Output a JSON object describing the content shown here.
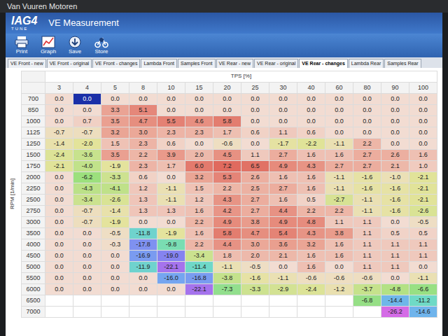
{
  "frame": {
    "label": "Van Vuuren Motoren"
  },
  "logo": {
    "text": "IAG4",
    "sub": "TUNE"
  },
  "window": {
    "title": "VE Measurement"
  },
  "toolbar": [
    {
      "label": "Print"
    },
    {
      "label": "Graph"
    },
    {
      "label": "Save"
    },
    {
      "label": "Store"
    }
  ],
  "tabs": [
    {
      "label": "VE Front - new",
      "selected": false
    },
    {
      "label": "VE Front - original",
      "selected": false
    },
    {
      "label": "VE Front - changes",
      "selected": false
    },
    {
      "label": "Lambda Front",
      "selected": false
    },
    {
      "label": "Samples Front",
      "selected": false
    },
    {
      "label": "VE Rear - new",
      "selected": false
    },
    {
      "label": "VE Rear - original",
      "selected": false
    },
    {
      "label": "VE Rear - changes",
      "selected": true
    },
    {
      "label": "Lambda Rear",
      "selected": false
    },
    {
      "label": "Samples Rear",
      "selected": false
    }
  ],
  "table": {
    "x_axis": "TPS [%]",
    "y_axis": "RPM [1/min]",
    "columns": [
      "3",
      "4",
      "5",
      "8",
      "10",
      "15",
      "20",
      "25",
      "30",
      "40",
      "60",
      "80",
      "90",
      "100"
    ],
    "selected_cell": {
      "row": "700",
      "column": "4"
    },
    "rows": [
      {
        "label": "700",
        "cells": [
          "0.0",
          "0.0",
          "0.0",
          "0.0",
          "0.0",
          "0.0",
          "0.0",
          "0.0",
          "0.0",
          "0.0",
          "0.0",
          "0.0",
          "0.0",
          "0.0"
        ]
      },
      {
        "label": "850",
        "cells": [
          "0.0",
          "0.0",
          "3.3",
          "5.1",
          "0.0",
          "0.0",
          "0.0",
          "0.0",
          "0.0",
          "0.0",
          "0.0",
          "0.0",
          "0.0",
          "0.0"
        ]
      },
      {
        "label": "1000",
        "cells": [
          "0.0",
          "0.7",
          "3.5",
          "4.7",
          "5.5",
          "4.6",
          "5.8",
          "0.0",
          "0.0",
          "0.0",
          "0.0",
          "0.0",
          "0.0",
          "0.0"
        ]
      },
      {
        "label": "1125",
        "cells": [
          "-0.7",
          "-0.7",
          "3.2",
          "3.0",
          "2.3",
          "2.3",
          "1.7",
          "0.6",
          "1.1",
          "0.6",
          "0.0",
          "0.0",
          "0.0",
          "0.0"
        ]
      },
      {
        "label": "1250",
        "cells": [
          "-1.4",
          "-2.0",
          "1.5",
          "2.3",
          "0.6",
          "0.0",
          "-0.6",
          "0.0",
          "-1.7",
          "-2.2",
          "-1.1",
          "2.2",
          "0.0",
          "0.0"
        ]
      },
      {
        "label": "1500",
        "cells": [
          "-2.4",
          "-3.6",
          "3.5",
          "2.2",
          "3.9",
          "2.0",
          "4.5",
          "1.1",
          "2.7",
          "1.6",
          "1.6",
          "2.7",
          "2.6",
          "1.6"
        ]
      },
      {
        "label": "1750",
        "cells": [
          "-2.1",
          "-4.0",
          "-1.9",
          "2.3",
          "1.7",
          "6.0",
          "7.2",
          "6.5",
          "4.9",
          "4.3",
          "2.7",
          "2.7",
          "2.1",
          "1.0"
        ]
      },
      {
        "label": "2000",
        "cells": [
          "0.0",
          "-6.2",
          "-3.3",
          "0.6",
          "0.0",
          "3.2",
          "5.3",
          "2.6",
          "1.6",
          "1.6",
          "-1.1",
          "-1.6",
          "-1.0",
          "-2.1"
        ]
      },
      {
        "label": "2250",
        "cells": [
          "0.0",
          "-4.3",
          "-4.1",
          "1.2",
          "-1.1",
          "1.5",
          "2.2",
          "2.5",
          "2.7",
          "1.6",
          "-1.1",
          "-1.6",
          "-1.6",
          "-2.1"
        ]
      },
      {
        "label": "2500",
        "cells": [
          "0.0",
          "-3.4",
          "-2.6",
          "1.3",
          "-1.1",
          "1.2",
          "4.3",
          "2.7",
          "1.6",
          "0.5",
          "-2.7",
          "-1.1",
          "-1.6",
          "-2.1"
        ]
      },
      {
        "label": "2750",
        "cells": [
          "0.0",
          "-0.7",
          "-1.4",
          "1.3",
          "1.3",
          "1.6",
          "4.2",
          "2.7",
          "4.4",
          "2.2",
          "2.2",
          "-1.1",
          "-1.6",
          "-2.6"
        ]
      },
      {
        "label": "3000",
        "cells": [
          "0.0",
          "-0.7",
          "-1.9",
          "0.0",
          "0.0",
          "2.2",
          "4.9",
          "3.8",
          "4.9",
          "4.8",
          "1.1",
          "1.1",
          "0.0",
          "-0.5"
        ]
      },
      {
        "label": "3500",
        "cells": [
          "0.0",
          "0.0",
          "-0.5",
          "-11.8",
          "-1.9",
          "1.6",
          "5.8",
          "4.7",
          "5.4",
          "4.3",
          "3.8",
          "1.1",
          "0.5",
          "0.5"
        ]
      },
      {
        "label": "4000",
        "cells": [
          "0.0",
          "0.0",
          "-0.3",
          "-17.8",
          "-9.8",
          "2.2",
          "4.4",
          "3.0",
          "3.6",
          "3.2",
          "1.6",
          "1.1",
          "1.1",
          "1.1"
        ]
      },
      {
        "label": "4500",
        "cells": [
          "0.0",
          "0.0",
          "0.0",
          "-16.9",
          "-19.0",
          "-3.4",
          "1.8",
          "2.0",
          "2.1",
          "1.6",
          "1.6",
          "1.1",
          "1.1",
          "1.1"
        ]
      },
      {
        "label": "5000",
        "cells": [
          "0.0",
          "0.0",
          "0.0",
          "-11.9",
          "-22.1",
          "-11.4",
          "-1.1",
          "-0.5",
          "0.0",
          "1.6",
          "0.0",
          "1.1",
          "1.1",
          "0.0"
        ]
      },
      {
        "label": "5500",
        "cells": [
          "0.0",
          "0.0",
          "0.0",
          "0.0",
          "-16.0",
          "-16.8",
          "-3.8",
          "-1.6",
          "-1.1",
          "-0.6",
          "-0.6",
          "-0.6",
          "0.0",
          "-1.1"
        ]
      },
      {
        "label": "6000",
        "cells": [
          "0.0",
          "0.0",
          "0.0",
          "0.0",
          "0.0",
          "-22.1",
          "-7.3",
          "-3.3",
          "-2.9",
          "-2.4",
          "-1.2",
          "-3.7",
          "-4.8",
          "-6.6"
        ]
      },
      {
        "label": "6500",
        "cells": [
          "",
          "",
          "",
          "",
          "",
          "",
          "",
          "",
          "",
          "",
          "",
          "-6.8",
          "-14.4",
          "-11.2"
        ]
      },
      {
        "label": "7000",
        "cells": [
          "",
          "",
          "",
          "",
          "",
          "",
          "",
          "",
          "",
          "",
          "",
          "",
          "-26.2",
          "-14.6"
        ]
      }
    ]
  }
}
